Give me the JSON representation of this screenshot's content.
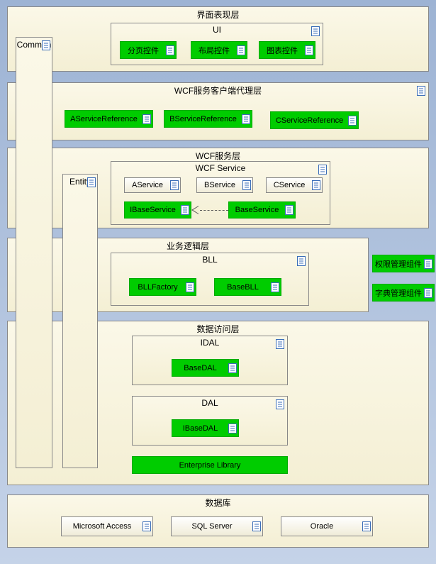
{
  "layers": {
    "presentation": {
      "title": "界面表现层"
    },
    "wcfProxy": {
      "title": "WCF服务客户端代理层"
    },
    "wcfService": {
      "title": "WCF服务层",
      "inner": "WCF Service"
    },
    "bll": {
      "title": "业务逻辑层",
      "inner": "BLL"
    },
    "dal": {
      "title": "数据访问层",
      "idal": "IDAL",
      "dal2": "DAL"
    },
    "db": {
      "title": "数据库"
    }
  },
  "boxes": {
    "common": "Common",
    "entity": "Entity",
    "ui": "UI",
    "pagerCtrl": "分页控件",
    "layoutCtrl": "布局控件",
    "chartCtrl": "图表控件",
    "aRef": "AServiceReference",
    "bRef": "BServiceReference",
    "cRef": "CServiceReference",
    "aSvc": "AService",
    "bSvc": "BService",
    "cSvc": "CService",
    "iBaseSvc": "IBaseService",
    "baseSvc": "BaseService",
    "bllFactory": "BLLFactory",
    "baseBLL": "BaseBLL",
    "authComp": "权限管理组件",
    "dictComp": "字典管理组件",
    "baseDAL": "BaseDAL",
    "iBaseDAL": "IBaseDAL",
    "entLib": "Enterprise Library",
    "access": "Microsoft Access",
    "sqlServer": "SQL Server",
    "oracle": "Oracle"
  }
}
